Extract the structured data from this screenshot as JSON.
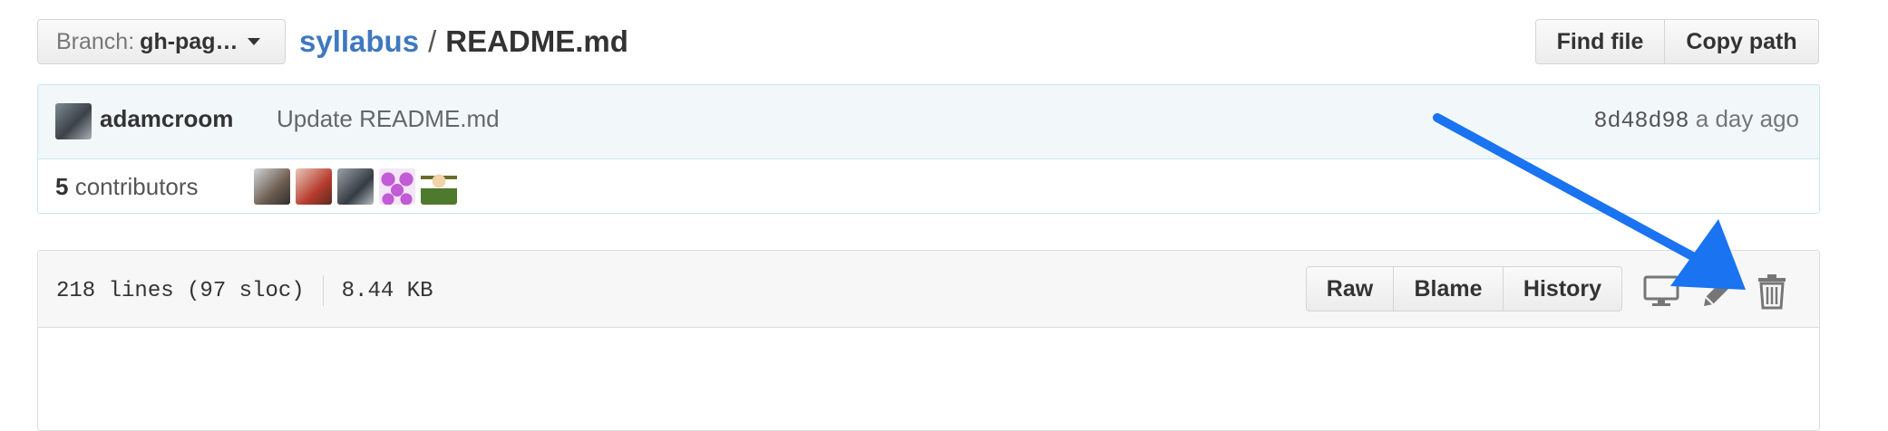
{
  "header": {
    "branch_label": "Branch:",
    "branch_value": "gh-pag…",
    "repo": "syllabus",
    "separator": "/",
    "file": "README.md",
    "find_file": "Find file",
    "copy_path": "Copy path"
  },
  "commit": {
    "author": "adamcroom",
    "message": "Update README.md",
    "sha": "8d48d98",
    "time": "a day ago"
  },
  "contributors": {
    "count": "5",
    "label": "contributors"
  },
  "file_header": {
    "lines": "218 lines (97 sloc)",
    "size": "8.44 KB",
    "raw": "Raw",
    "blame": "Blame",
    "history": "History"
  },
  "icons": [
    "chevron-down-icon",
    "desktop-icon",
    "pencil-icon",
    "trash-icon",
    "annotation-arrow"
  ],
  "colors": {
    "link": "#4078c0",
    "commit_bg": "#f2f8fa",
    "commit_border": "#c9e6f2",
    "arrow": "#1a73f0"
  }
}
